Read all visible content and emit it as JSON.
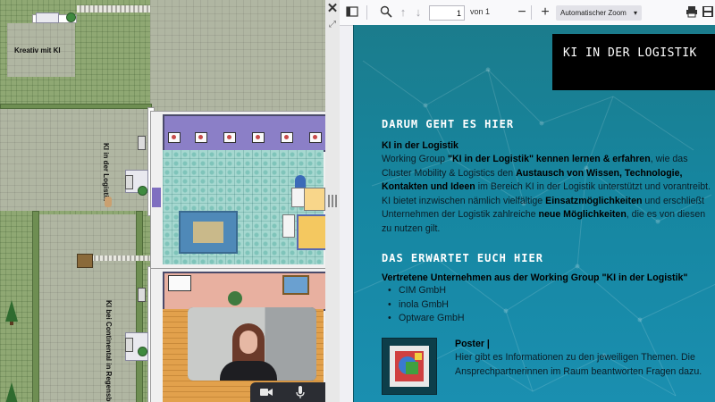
{
  "map": {
    "labels": {
      "kreativ": "Kreativ mit KI",
      "logistik": "KI in der Logistik",
      "continental": "KI bei Continental in Regensburg"
    }
  },
  "camera": {
    "controls": {
      "video_icon": "video-camera-icon",
      "mic_icon": "microphone-icon"
    }
  },
  "splitter": {
    "close_icon": "close-icon",
    "expand_icon": "expand-icon"
  },
  "pdf_toolbar": {
    "page_current": "1",
    "page_of": "von 1",
    "zoom_value": "Automatischer Zoom",
    "icons": [
      "sidebar-toggle-icon",
      "search-icon",
      "previous-page-icon",
      "next-page-icon",
      "zoom-out-icon",
      "zoom-in-icon",
      "print-icon",
      "save-icon"
    ]
  },
  "pdf": {
    "title": "KI IN DER LOGISTIK",
    "section1": {
      "heading": "DARUM GEHT ES HIER",
      "subheading": "KI in der Logistik",
      "t1": "Working Group ",
      "b1": "\"KI in der Logistik\" kennen lernen & erfahren",
      "t2": ", wie das Cluster Mobility & Logistics den ",
      "b2": "Austausch von Wissen, Technologie, Kontakten und Ideen",
      "t3": " im Bereich KI in der Logistik unterstützt und vorantreibt. KI bietet inzwischen nämlich vielfältige ",
      "b3": "Einsatzmöglichkeiten",
      "t4": " und erschließt Unternehmen der Logistik zahlreiche ",
      "b4": "neue Möglichkeiten",
      "t5": ", die es von diesen zu nutzen gilt."
    },
    "section2": {
      "heading": "DAS ERWARTET EUCH HIER",
      "companies_intro": "Vertretene Unternehmen aus der Working Group \"KI in der Logistik\"",
      "companies": [
        "CIM GmbH",
        "inola GmbH",
        "Optware GmbH"
      ]
    },
    "poster": {
      "label": "Poster |",
      "text": "Hier gibt es Informationen zu den jeweiligen Themen. Die Ansprechpartnerinnen im Raum beantworten Fragen dazu."
    }
  },
  "colors": {
    "pdf_bg": "#1686a0",
    "title_box": "#000000",
    "roof": "#8b7fc7",
    "toolbar": "#f9f9fb"
  }
}
